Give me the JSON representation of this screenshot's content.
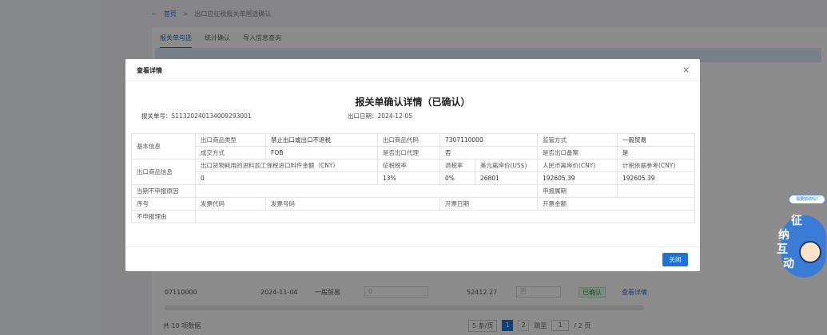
{
  "background": {
    "back": "←",
    "crumb_home": "首页",
    "crumb_sep": ">",
    "crumb_current": "出口应征税报关单用途确认",
    "tabs": [
      "报关单勾选",
      "统计确认",
      "导入信息查询"
    ],
    "bottom_row": {
      "code": "07110000",
      "date": "2024-11-04",
      "trade": "一般贸易",
      "input_placeholder": "0",
      "amount": "52412.27",
      "select_placeholder": "否",
      "status": "已确认",
      "link": "查看详情"
    },
    "footer": {
      "total": "共 10 项数据",
      "page_size": "5 条/页",
      "pages": [
        "1",
        "2"
      ],
      "goto_label": "跳至",
      "goto_value": "1",
      "page_total": "/ 2 页"
    }
  },
  "side_widget": {
    "tag": "需要帮助吗?",
    "chars": [
      "征",
      "纳",
      "互",
      "动"
    ]
  },
  "modal": {
    "title": "查看详情",
    "close_icon": "×",
    "doc_title": "报关单确认详情（已确认）",
    "decl_no_label": "报关单号：",
    "decl_no": "511320240134009293001",
    "export_date_label": "出口日期：",
    "export_date": "2024-12-05",
    "table": {
      "basic_info": "基本信息",
      "product_type_label": "出口商品类型",
      "product_type": "禁止出口或出口不退税",
      "product_code_label": "出口商品代码",
      "product_code": "7307110000",
      "supervision_label": "监管方式",
      "supervision": "一般贸易",
      "deal_method_label": "成交方式",
      "deal_method": "FOB",
      "agency_label": "是否出口代理",
      "agency": "否",
      "record_label": "是否出口备案",
      "record": "是",
      "product_info": "出口商品信息",
      "bonded_label": "出口货物耗用的进料加工保税进口料件金额（CNY）",
      "tax_rate_label": "征税税率",
      "refund_rate_label": "退税率",
      "usd_price_label": "美元离岸价(US$)",
      "cny_price_label": "人民币离岸价(CNY)",
      "tax_basis_label": "计税依据参考(CNY)",
      "bonded": "0",
      "tax_rate": "13%",
      "refund_rate": "0%",
      "usd_price": "26801",
      "cny_price": "192605.39",
      "tax_basis": "192605.39",
      "no_declare_reason_label": "当期不申报原因",
      "declare_period_label": "申报属期",
      "seq_label": "序号",
      "invoice_code_label": "发票代码",
      "invoice_no_label": "发票号码",
      "invoice_date_label": "开票日期",
      "invoice_amount_label": "开票金额",
      "no_declare_basis_label": "不申报理由"
    },
    "close_button": "关闭"
  }
}
